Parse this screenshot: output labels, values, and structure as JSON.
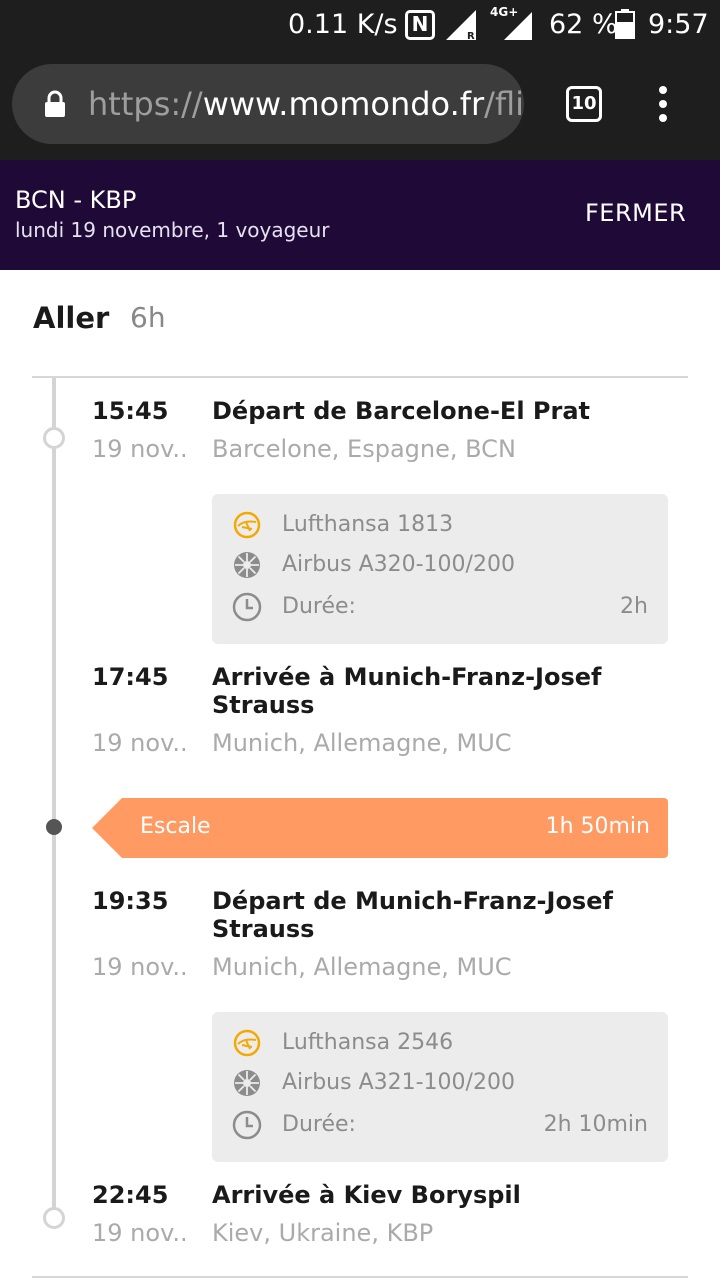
{
  "status_bar": {
    "speed": "0.11 K/s",
    "nfc": "N",
    "network": "4G+",
    "battery": "62 %",
    "time": "9:57"
  },
  "browser": {
    "url_scheme": "https://",
    "url_host": "www.momondo.fr",
    "url_path": "/flig",
    "tab_count": "10"
  },
  "header": {
    "route": "BCN - KBP",
    "subtitle": "lundi 19 novembre, 1 voyageur",
    "close_label": "FERMER",
    "bg_color": "#1f0a37"
  },
  "trip": {
    "direction": "Aller",
    "duration": "6h"
  },
  "segments": [
    {
      "dep_time": "15:45",
      "dep_date": "19 nov..",
      "dep_title": "Départ de Barcelone-El Prat",
      "dep_loc": "Barcelone, Espagne, BCN",
      "airline": "Lufthansa 1813",
      "aircraft": "Airbus A320-100/200",
      "duration_label": "Durée:",
      "duration": "2h",
      "arr_time": "17:45",
      "arr_date": "19 nov..",
      "arr_title": "Arrivée à Munich-Franz-Josef Strauss",
      "arr_loc": "Munich, Allemagne, MUC"
    },
    {
      "dep_time": "19:35",
      "dep_date": "19 nov..",
      "dep_title": "Départ de Munich-Franz-Josef Strauss",
      "dep_loc": "Munich, Allemagne, MUC",
      "airline": "Lufthansa 2546",
      "aircraft": "Airbus A321-100/200",
      "duration_label": "Durée:",
      "duration": "2h 10min",
      "arr_time": "22:45",
      "arr_date": "19 nov..",
      "arr_title": "Arrivée à Kiev Boryspil",
      "arr_loc": "Kiev, Ukraine, KBP"
    }
  ],
  "layover": {
    "label": "Escale",
    "duration": "1h 50min",
    "color": "#ff9a63"
  },
  "icons": {
    "airline": "lufthansa-crane-icon",
    "aircraft": "engine-icon",
    "duration": "clock-icon"
  }
}
